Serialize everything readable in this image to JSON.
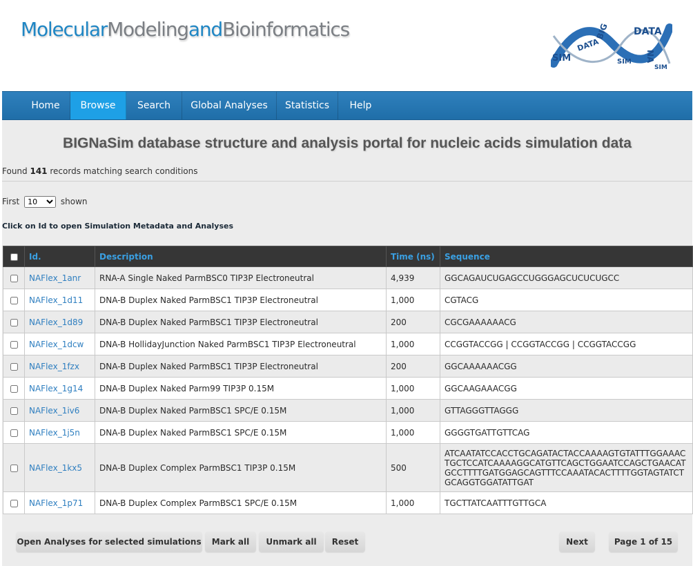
{
  "header": {
    "brand_part1": "Molecular",
    "brand_part2": "Modeling",
    "brand_part3": "and",
    "brand_part4": "Bioinformatics",
    "logo_icon": "bignasim-logo"
  },
  "nav": {
    "items": [
      "Home",
      "Browse",
      "Search",
      "Global Analyses",
      "Statistics",
      "Help"
    ],
    "active": "Browse"
  },
  "page": {
    "title": "BIGNaSim database structure and analysis portal for nucleic acids simulation data",
    "found_prefix": "Found",
    "found_count": "141",
    "found_suffix": "records matching search conditions",
    "first_label": "First",
    "first_value": "10",
    "shown_label": "shown",
    "click_hint": "Click on Id to open Simulation Metadata and Analyses"
  },
  "table": {
    "headers": [
      "Id.",
      "Description",
      "Time (ns)",
      "Sequence"
    ],
    "rows": [
      {
        "id": "NAFlex_1anr",
        "desc": "RNA-A Single Naked ParmBSC0 TIP3P Electroneutral",
        "time": "4,939",
        "seq": "GGCAGAUCUGAGCCUGGGAGCUCUCUGCC"
      },
      {
        "id": "NAFlex_1d11",
        "desc": "DNA-B Duplex Naked ParmBSC1 TIP3P Electroneutral",
        "time": "1,000",
        "seq": "CGTACG"
      },
      {
        "id": "NAFlex_1d89",
        "desc": "DNA-B Duplex Naked ParmBSC1 TIP3P Electroneutral",
        "time": "200",
        "seq": "CGCGAAAAAACG"
      },
      {
        "id": "NAFlex_1dcw",
        "desc": "DNA-B HollidayJunction Naked ParmBSC1 TIP3P Electroneutral",
        "time": "1,000",
        "seq": "CCGGTACCGG | CCGGTACCGG | CCGGTACCGG"
      },
      {
        "id": "NAFlex_1fzx",
        "desc": "DNA-B Duplex Naked ParmBSC1 TIP3P Electroneutral",
        "time": "200",
        "seq": "GGCAAAAAACGG"
      },
      {
        "id": "NAFlex_1g14",
        "desc": "DNA-B Duplex Naked Parm99 TIP3P 0.15M",
        "time": "1,000",
        "seq": "GGCAAGAAACGG"
      },
      {
        "id": "NAFlex_1iv6",
        "desc": "DNA-B Duplex Naked ParmBSC1 SPC/E 0.15M",
        "time": "1,000",
        "seq": "GTTAGGGTTAGGG"
      },
      {
        "id": "NAFlex_1j5n",
        "desc": "DNA-B Duplex Naked ParmBSC1 SPC/E 0.15M",
        "time": "1,000",
        "seq": "GGGGTGATTGTTCAG"
      },
      {
        "id": "NAFlex_1kx5",
        "desc": "DNA-B Duplex Complex ParmBSC1 TIP3P 0.15M",
        "time": "500",
        "seq": "ATCAATATCCACCTGCAGATACTACCAAAAGTGTATTTGGAAACTGCTCCATCAAAAGGCATGTTCAGCTGGAATCCAGCTGAACATGCCTTTTGATGGAGCAGTTTCCAAATACACTTTTGGTAGTATCTGCAGGTGGATATTGAT"
      },
      {
        "id": "NAFlex_1p71",
        "desc": "DNA-B Duplex Complex ParmBSC1 SPC/E 0.15M",
        "time": "1,000",
        "seq": "TGCTTATCAATTTGTTGCA"
      }
    ]
  },
  "buttons": {
    "open_analyses": "Open Analyses for selected simulations",
    "mark_all": "Mark all",
    "unmark_all": "Unmark all",
    "reset": "Reset",
    "next": "Next",
    "page_info": "Page 1 of 15"
  }
}
